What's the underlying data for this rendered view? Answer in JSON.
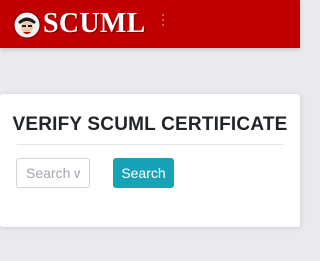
{
  "header": {
    "logo_text": "SCUML",
    "logo_icon": "mascot-logo-icon",
    "menu_icon": "vertical-dots-icon",
    "background_color": "#c00000"
  },
  "card": {
    "title": "VERIFY SCUML CERTIFICATE",
    "search_placeholder": "Search wi",
    "search_button_label": "Search",
    "button_color": "#17a2b8"
  }
}
